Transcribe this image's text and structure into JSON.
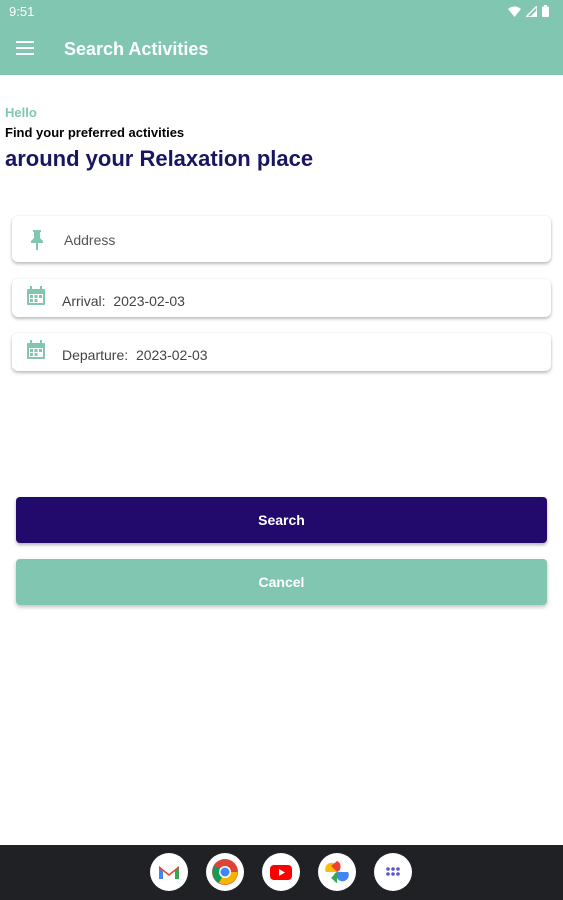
{
  "status_bar": {
    "time": "9:51"
  },
  "app_bar": {
    "title": "Search Activities"
  },
  "greeting": {
    "hello": "Hello",
    "subtitle": "Find your preferred activities",
    "headline": "around your Relaxation place"
  },
  "form": {
    "address_placeholder": "Address",
    "arrival_label": "Arrival:",
    "arrival_date": "2023-02-03",
    "departure_label": "Departure:",
    "departure_date": "2023-02-03"
  },
  "buttons": {
    "search": "Search",
    "cancel": "Cancel"
  },
  "colors": {
    "primary": "#80c6b1",
    "accent": "#210a6c",
    "headline": "#1a1560"
  },
  "dock_apps": [
    "gmail-icon",
    "chrome-icon",
    "youtube-icon",
    "photos-icon",
    "app-drawer-icon"
  ]
}
